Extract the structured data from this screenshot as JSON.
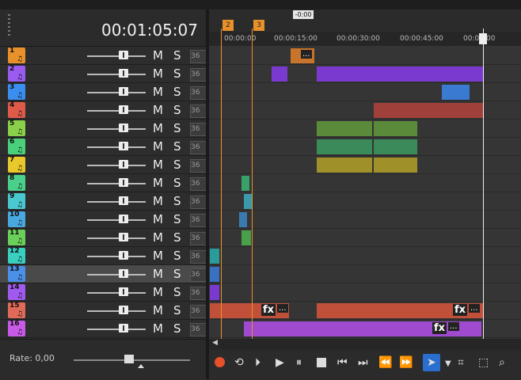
{
  "timecode": "00:01:05:07",
  "playhead_label": "-0:00",
  "markers": [
    "2",
    "3"
  ],
  "ruler_labels": [
    "00:00:00",
    "00:00:15:00",
    "00:00:30:00",
    "00:00:45:00",
    "00:01:00"
  ],
  "tracks": [
    {
      "num": "1",
      "color": "#e8902a",
      "mute": "M",
      "solo": "S",
      "pan": "36"
    },
    {
      "num": "2",
      "color": "#9a5bf0",
      "mute": "M",
      "solo": "S",
      "pan": "36"
    },
    {
      "num": "3",
      "color": "#3a8ef0",
      "mute": "M",
      "solo": "S",
      "pan": "36"
    },
    {
      "num": "4",
      "color": "#e05a4a",
      "mute": "M",
      "solo": "S",
      "pan": "36"
    },
    {
      "num": "5",
      "color": "#8ad04a",
      "mute": "M",
      "solo": "S",
      "pan": "36"
    },
    {
      "num": "6",
      "color": "#4ad07a",
      "mute": "M",
      "solo": "S",
      "pan": "36"
    },
    {
      "num": "7",
      "color": "#e8c82a",
      "mute": "M",
      "solo": "S",
      "pan": "36"
    },
    {
      "num": "8",
      "color": "#4ad08a",
      "mute": "M",
      "solo": "S",
      "pan": "36"
    },
    {
      "num": "9",
      "color": "#4ac8d0",
      "mute": "M",
      "solo": "S",
      "pan": "36"
    },
    {
      "num": "10",
      "color": "#4aa8e0",
      "mute": "M",
      "solo": "S",
      "pan": "36"
    },
    {
      "num": "11",
      "color": "#6ad05a",
      "mute": "M",
      "solo": "S",
      "pan": "36"
    },
    {
      "num": "12",
      "color": "#3ad0c0",
      "mute": "M",
      "solo": "S",
      "pan": "36"
    },
    {
      "num": "13",
      "color": "#4a90e8",
      "mute": "M",
      "solo": "S",
      "pan": "36"
    },
    {
      "num": "14",
      "color": "#a05af0",
      "mute": "M",
      "solo": "S",
      "pan": "36"
    },
    {
      "num": "15",
      "color": "#e06a5a",
      "mute": "M",
      "solo": "S",
      "pan": "36"
    },
    {
      "num": "16",
      "color": "#c85ae8",
      "mute": "M",
      "solo": "S",
      "pan": "36"
    }
  ],
  "rate_label": "Rate: 0,00",
  "fx_label": "fx",
  "ellipsis": "...",
  "note_glyph": "♫",
  "icons": [
    "record-icon",
    "loop-icon",
    "play-from-start-icon",
    "play-icon",
    "pause-icon",
    "stop-icon",
    "prev-marker-icon",
    "next-marker-icon",
    "prev-frame-icon",
    "next-frame-icon",
    "cursor-tool-icon",
    "dropdown-icon",
    "snap-icon",
    "selection-icon",
    "zoom-icon"
  ]
}
